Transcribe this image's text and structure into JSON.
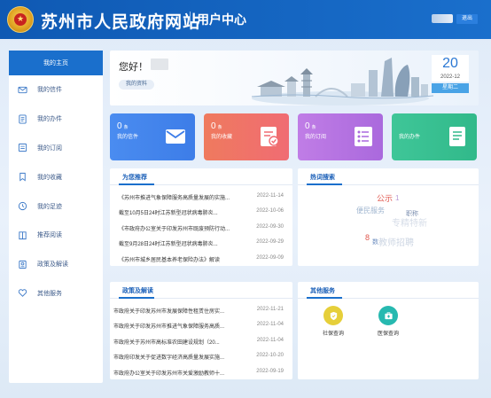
{
  "header": {
    "site_title": "苏州市人民政府网站",
    "sub_title": "用户中心",
    "logout_label": "退出"
  },
  "sidebar": {
    "items": [
      {
        "label": "我的主页",
        "icon": "home-icon"
      },
      {
        "label": "我的信件",
        "icon": "mail-icon"
      },
      {
        "label": "我的办件",
        "icon": "document-icon"
      },
      {
        "label": "我的订阅",
        "icon": "subscribe-icon"
      },
      {
        "label": "我的收藏",
        "icon": "bookmark-icon"
      },
      {
        "label": "我的足迹",
        "icon": "footprint-icon"
      },
      {
        "label": "推荐阅读",
        "icon": "book-icon"
      },
      {
        "label": "政策及解读",
        "icon": "policy-icon"
      },
      {
        "label": "其他服务",
        "icon": "heart-icon"
      }
    ]
  },
  "banner": {
    "greeting": "您好！",
    "profile_label": "我的资料",
    "date_day": "20",
    "date_ym": "2022-12",
    "date_weekday": "星期二"
  },
  "cards": [
    {
      "num": "0",
      "unit": "条",
      "label": "我的信件",
      "icon": "envelope-icon",
      "color": "#3d7de8"
    },
    {
      "num": "0",
      "unit": "条",
      "label": "我的收藏",
      "icon": "checklist-icon",
      "color": "#f06c73"
    },
    {
      "num": "0",
      "unit": "条",
      "label": "我的订阅",
      "icon": "list-icon",
      "color": "#aa69dd"
    },
    {
      "num": "",
      "unit": "",
      "label": "我的办件",
      "icon": "file-icon",
      "color": "#31b98a"
    }
  ],
  "recommend": {
    "title": "为您推荐",
    "items": [
      {
        "title": "《苏州市推进气象保障服务高质量发展的实施...",
        "date": "2022-11-14"
      },
      {
        "title": "截至10月5日24时江苏新型冠状病毒肺炎...",
        "date": "2022-10-06"
      },
      {
        "title": "《市政府办公室关于印发苏州市既废预防行动...",
        "date": "2022-09-30"
      },
      {
        "title": "截至9月28日24时江苏新型冠状病毒肺炎...",
        "date": "2022-09-29"
      },
      {
        "title": "《苏州市城乡居民基本养老保险办法》解读",
        "date": "2022-09-09"
      }
    ]
  },
  "hot_search": {
    "title": "热词搜索",
    "words": [
      "公示",
      "1",
      "便民服务",
      "职称",
      "专精特新",
      "8",
      "数",
      "教师招聘"
    ]
  },
  "policy": {
    "title": "政策及解读",
    "items": [
      {
        "title": "市政府关于印发苏州市发展保障性租赁住房实...",
        "date": "2022-11-21"
      },
      {
        "title": "市政府关于印发苏州市推进气象保障服务高质...",
        "date": "2022-11-04"
      },
      {
        "title": "市政府关于苏州市高标准农田建设规划（20...",
        "date": "2022-11-04"
      },
      {
        "title": "市政府印发关于促进数字经济高质量发展实施...",
        "date": "2022-10-20"
      },
      {
        "title": "市政府办公室关于印发苏州市关爱激励教师十...",
        "date": "2022-09-19"
      }
    ]
  },
  "other": {
    "title": "其他服务",
    "services": [
      {
        "label": "社保查询",
        "icon": "shield-icon",
        "color": "#e6cf3a"
      },
      {
        "label": "医保查询",
        "icon": "medical-kit-icon",
        "color": "#27b9b0"
      }
    ]
  }
}
